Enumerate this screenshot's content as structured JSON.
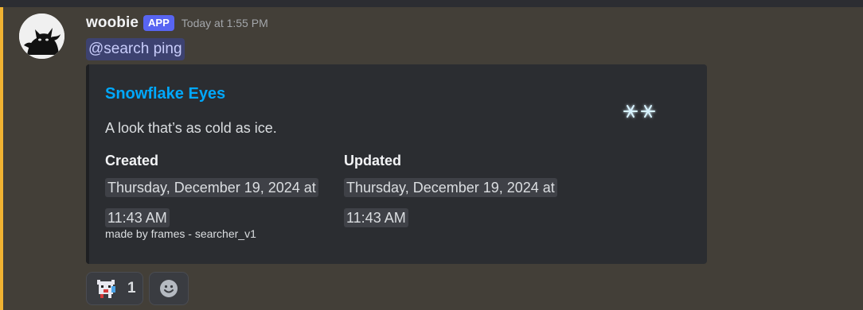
{
  "message": {
    "author": "woobie",
    "badge": "APP",
    "timestamp": "Today at 1:55 PM",
    "mention": "@search ping"
  },
  "embed": {
    "title": "Snowflake Eyes",
    "description": "A look that’s as cold as ice.",
    "thumbnail_icon": "snowflake-eyes-emoji",
    "fields": [
      {
        "name": "Created",
        "value": "Thursday, December 19, 2024 at 11:43 AM"
      },
      {
        "name": "Updated",
        "value": "Thursday, December 19, 2024 at 11:43 AM"
      }
    ],
    "footer": "made by frames - searcher_v1"
  },
  "reactions": [
    {
      "icon": "pixel-creature-emoji",
      "count": "1"
    }
  ],
  "add_reaction_icon": "smiley-add-reaction-icon",
  "colors": {
    "accent_link": "#00a8fc",
    "badge": "#5865f2",
    "mention_bg": "#3d4270",
    "highlight": "#f0b232"
  }
}
